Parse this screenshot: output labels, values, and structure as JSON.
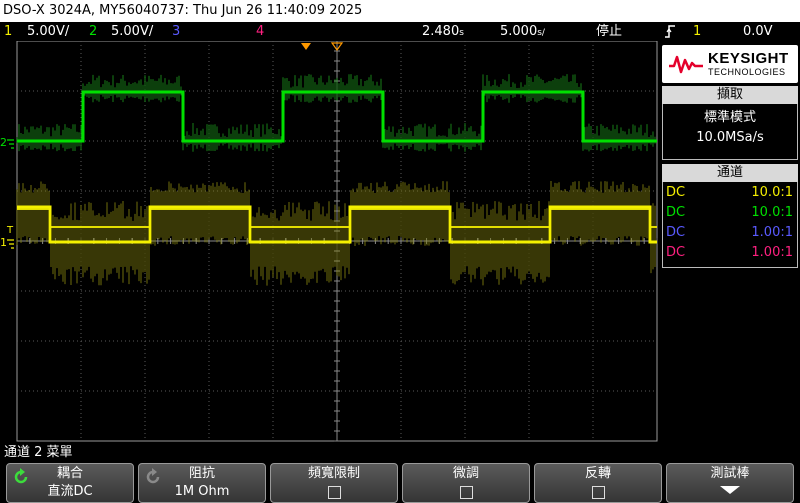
{
  "titlebar": "DSO-X 3024A, MY56040737: Thu Jun 26 11:40:09 2025",
  "colors": {
    "ch1": "#f4f000",
    "ch2": "#00e000",
    "ch3": "#5a5aff",
    "ch4": "#ff2080",
    "trigger_marker": "#ff9900",
    "grid": "#5a5a5a"
  },
  "status": {
    "ch1_num": "1",
    "ch1_scale": "5.00V/",
    "ch2_num": "2",
    "ch2_scale": "5.00V/",
    "ch3_num": "3",
    "ch4_num": "4",
    "time_delay": "2.480",
    "time_delay_unit": "s",
    "timebase": "5.000",
    "timebase_unit": "s/",
    "run_state": "停止",
    "trigger_icon": "rising-edge-icon",
    "trigger_source": "1",
    "trigger_level": "0.0V"
  },
  "markers": {
    "ch1_ground": "1",
    "ch2_ground": "2",
    "trigger_level": "T"
  },
  "side": {
    "brand": "KEYSIGHT",
    "brand_sub": "TECHNOLOGIES",
    "acq_title": "擷取",
    "acq_mode": "標準模式",
    "acq_rate": "10.0MSa/s",
    "channels_title": "通道",
    "probes": [
      {
        "coupling": "DC",
        "ratio": "10.0:1"
      },
      {
        "coupling": "DC",
        "ratio": "10.0:1"
      },
      {
        "coupling": "DC",
        "ratio": "1.00:1"
      },
      {
        "coupling": "DC",
        "ratio": "1.00:1"
      }
    ]
  },
  "menu_title": "通道 2 菜單",
  "softkeys": [
    {
      "label": "耦合",
      "value": "直流DC",
      "icon": "rotate-knob-icon"
    },
    {
      "label": "阻抗",
      "value": "1M Ohm",
      "icon": "rotate-knob-icon"
    },
    {
      "label": "頻寬限制",
      "checked": false
    },
    {
      "label": "微調",
      "checked": false
    },
    {
      "label": "反轉",
      "checked": false
    },
    {
      "label": "測試棒",
      "icon": "down-arrow-icon"
    }
  ]
}
